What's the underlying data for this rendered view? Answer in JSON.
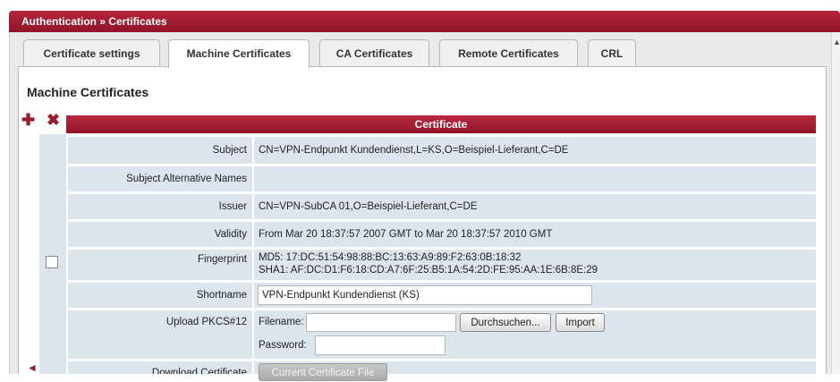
{
  "breadcrumb": "Authentication » Certificates",
  "tabs": [
    "Certificate settings",
    "Machine Certificates",
    "CA Certificates",
    "Remote Certificates",
    "CRL"
  ],
  "active_tab": "Machine Certificates",
  "section_title": "Machine Certificates",
  "icons": {
    "add": "add-icon",
    "delete": "delete-icon"
  },
  "table": {
    "column_header": "Certificate",
    "subject_label": "Subject",
    "subject_value": "CN=VPN-Endpunkt Kundendienst,L=KS,O=Beispiel-Lieferant,C=DE",
    "san_label": "Subject Alternative Names",
    "san_value": "",
    "issuer_label": "Issuer",
    "issuer_value": "CN=VPN-SubCA 01,O=Beispiel-Lieferant,C=DE",
    "validity_label": "Validity",
    "validity_value": "From Mar 20 18:37:57 2007 GMT to Mar 20 18:37:57 2010 GMT",
    "fingerprint_label": "Fingerprint",
    "fingerprint_md5": "MD5: 17:DC:51:54:98:88:BC:13:63:A9:89:F2:63:0B:18:32",
    "fingerprint_sha1": "SHA1: AF:DC:D1:F6:18:CD:A7:6F:25:B5:1A:54:2D:FE:95:AA:1E:6B:8E:29",
    "shortname_label": "Shortname",
    "shortname_value": "VPN-Endpunkt Kundendienst (KS)",
    "upload_label": "Upload PKCS#12",
    "filename_label": "Filename:",
    "filename_value": "",
    "browse_button": "Durchsuchen...",
    "import_button": "Import",
    "password_label": "Password:",
    "password_value": "",
    "download_label": "Download Certificate",
    "download_button": "Current Certificate File"
  }
}
